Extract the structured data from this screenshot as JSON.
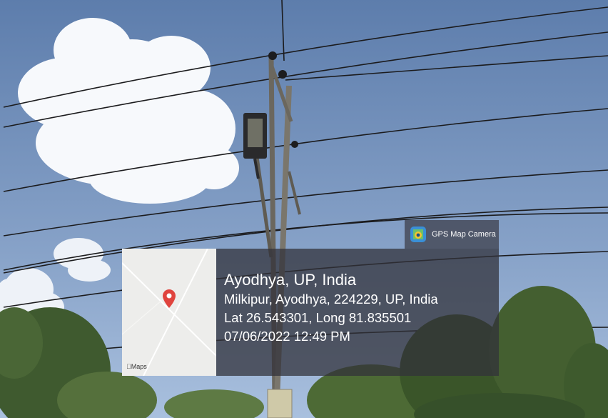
{
  "badge": {
    "app_name": "GPS Map Camera",
    "icon": "gps-map-camera-icon"
  },
  "map": {
    "provider_label": "Maps",
    "pin_icon": "location-pin-icon",
    "pin_color": "#e0443e"
  },
  "location": {
    "title": "Ayodhya, UP, India",
    "address": "Milkipur, Ayodhya, 224229, UP, India",
    "coordinates": "Lat 26.543301, Long 81.835501",
    "datetime": "07/06/2022 12:49 PM"
  },
  "colors": {
    "sky_top": "#5f7fae",
    "sky_bottom": "#a5bcdc",
    "overlay": "#32323a",
    "foliage": "#3d5a2e"
  }
}
